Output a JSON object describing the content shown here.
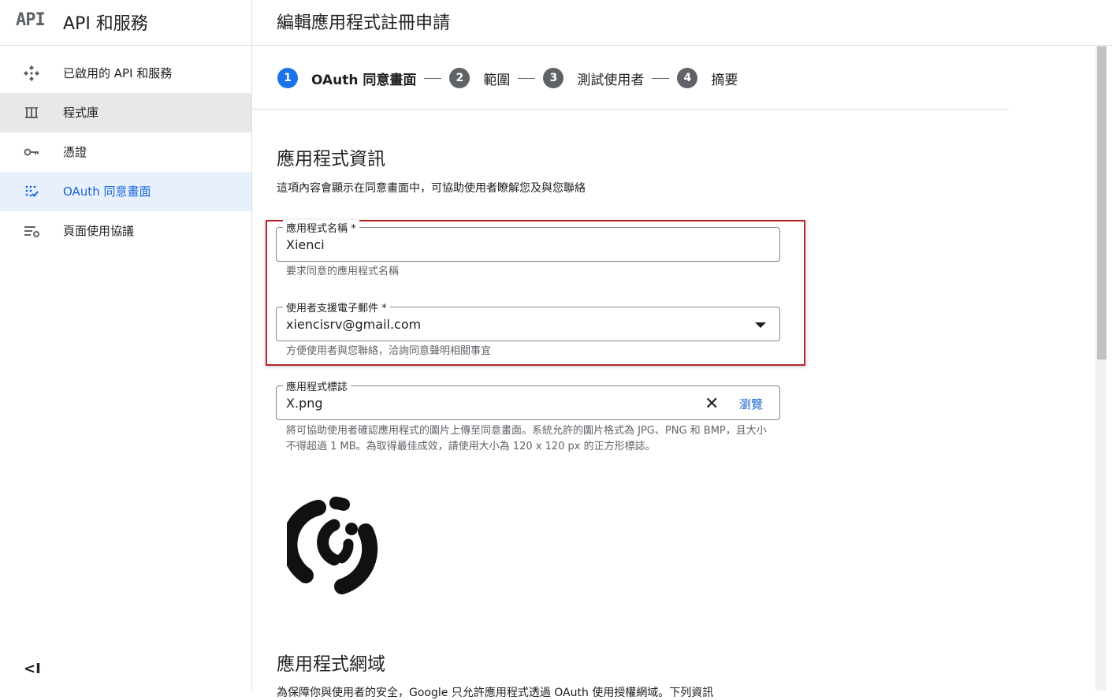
{
  "sidebar": {
    "logo": "API",
    "title": "API 和服務",
    "items": [
      {
        "label": "已啟用的 API 和服務",
        "icon": "api-diamond-icon"
      },
      {
        "label": "程式庫",
        "icon": "library-icon"
      },
      {
        "label": "憑證",
        "icon": "key-icon"
      },
      {
        "label": "OAuth 同意畫面",
        "icon": "oauth-consent-icon"
      },
      {
        "label": "頁面使用協議",
        "icon": "settings-list-icon"
      }
    ],
    "collapse": "<I"
  },
  "header": {
    "title": "編輯應用程式註冊申請"
  },
  "stepper": [
    {
      "num": "1",
      "label": "OAuth 同意畫面"
    },
    {
      "num": "2",
      "label": "範圍"
    },
    {
      "num": "3",
      "label": "測試使用者"
    },
    {
      "num": "4",
      "label": "摘要"
    }
  ],
  "app_info": {
    "title": "應用程式資訊",
    "description": "這項內容會顯示在同意畫面中，可協助使用者瞭解您及與您聯絡",
    "app_name": {
      "label": "應用程式名稱 *",
      "value": "Xienci",
      "hint": "要求同意的應用程式名稱"
    },
    "support_email": {
      "label": "使用者支援電子郵件 *",
      "value": "xiencisrv@gmail.com",
      "hint": "方便使用者與您聯絡，洽詢同意聲明相關事宜"
    },
    "logo": {
      "label": "應用程式標誌",
      "value": "X.png",
      "browse": "瀏覽",
      "hint": "將可協助使用者確認應用程式的圖片上傳至同意畫面。系統允許的圖片格式為 JPG、PNG 和 BMP，且大小不得超過 1 MB。為取得最佳成效，請使用大小為 120 x 120 px 的正方形標誌。"
    }
  },
  "app_domain": {
    "title": "應用程式網域",
    "description": "為保障你與使用者的安全，Google 只允許應用程式透過 OAuth 使用授權網域。下列資訊"
  },
  "colors": {
    "accent": "#1a73e8",
    "highlight_border": "#b3262b",
    "active_nav_bg": "#e8f0fe"
  }
}
